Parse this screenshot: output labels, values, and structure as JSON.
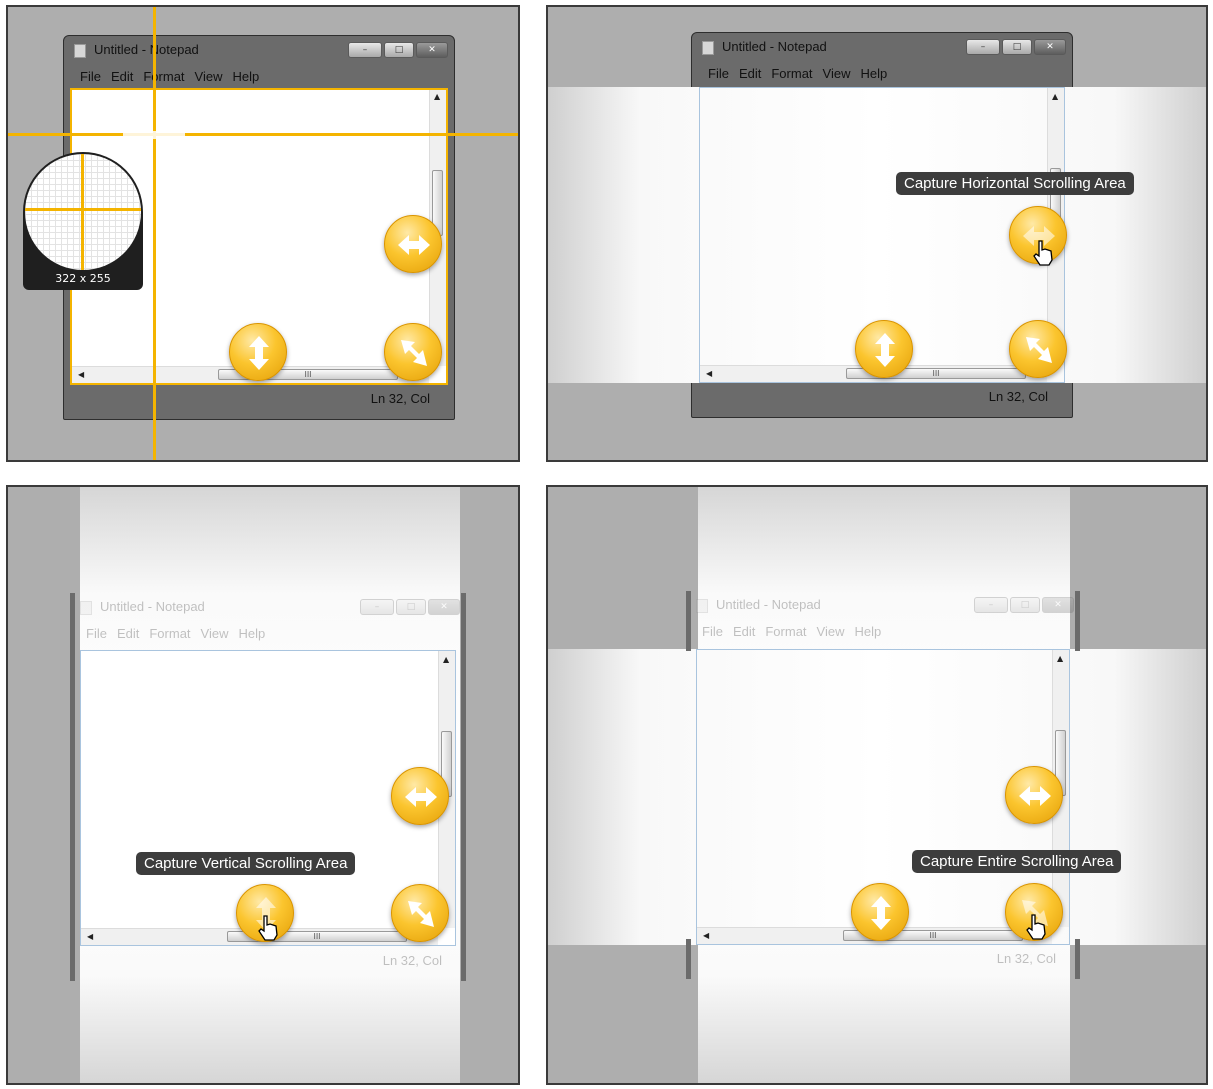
{
  "notepad": {
    "title": "Untitled - Notepad",
    "menu": [
      "File",
      "Edit",
      "Format",
      "View",
      "Help"
    ],
    "status": "Ln 32, Col",
    "scroll_grip": "III"
  },
  "magnifier": {
    "size_label": "322 x 255"
  },
  "tooltips": {
    "horizontal": "Capture Horizontal Scrolling Area",
    "vertical": "Capture Vertical Scrolling Area",
    "entire": "Capture Entire Scrolling Area"
  },
  "colors": {
    "accent": "#f4b400",
    "orb": "#fbc52e",
    "background": "#aeaeae"
  }
}
